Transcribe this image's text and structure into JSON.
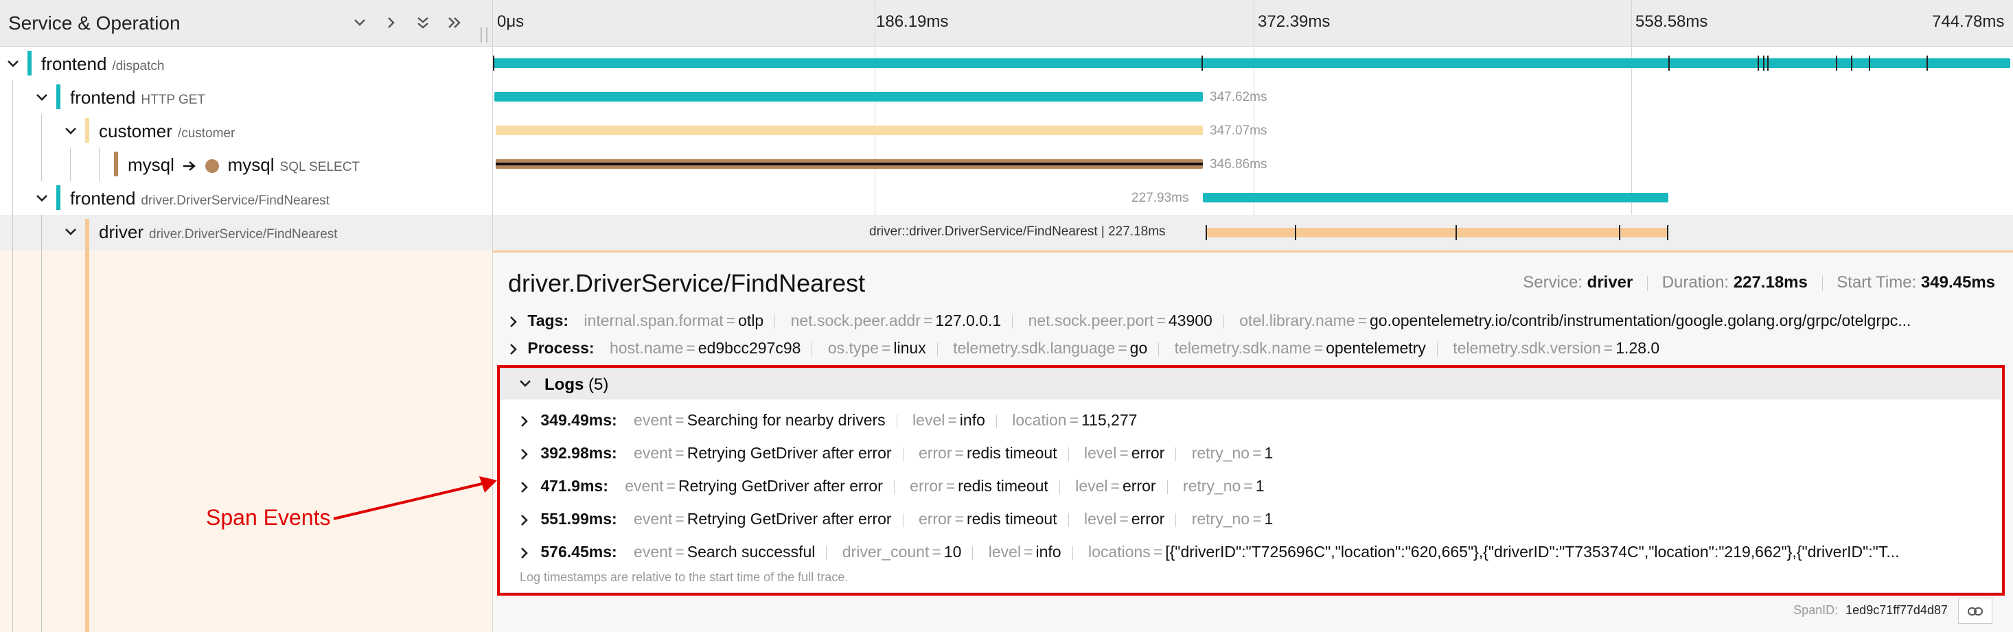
{
  "header": {
    "title": "Service & Operation",
    "ticks": [
      "0μs",
      "186.19ms",
      "372.39ms",
      "558.58ms",
      "744.78ms"
    ]
  },
  "rows": [
    {
      "service": "frontend",
      "operation": "/dispatch",
      "color": "#17b8be"
    },
    {
      "service": "frontend",
      "operation": "HTTP GET",
      "color": "#17b8be",
      "duration": "347.62ms"
    },
    {
      "service": "customer",
      "operation": "/customer",
      "color": "#f8dca1",
      "duration": "347.07ms"
    },
    {
      "service": "mysql",
      "peer": "mysql",
      "operation": "SQL SELECT",
      "color": "#b7885e",
      "duration": "346.86ms"
    },
    {
      "service": "frontend",
      "operation": "driver.DriverService/FindNearest",
      "color": "#17b8be",
      "duration": "227.93ms"
    },
    {
      "service": "driver",
      "operation": "driver.DriverService/FindNearest",
      "color": "#f7c994",
      "label": "driver::driver.DriverService/FindNearest | 227.18ms"
    }
  ],
  "detail": {
    "title": "driver.DriverService/FindNearest",
    "service_label": "Service:",
    "service": "driver",
    "duration_label": "Duration:",
    "duration": "227.18ms",
    "start_label": "Start Time:",
    "start": "349.45ms",
    "tags_label": "Tags:",
    "tags": [
      {
        "k": "internal.span.format",
        "v": "otlp"
      },
      {
        "k": "net.sock.peer.addr",
        "v": "127.0.0.1"
      },
      {
        "k": "net.sock.peer.port",
        "v": "43900"
      },
      {
        "k": "otel.library.name",
        "v": "go.opentelemetry.io/contrib/instrumentation/google.golang.org/grpc/otelgrpc..."
      }
    ],
    "process_label": "Process:",
    "process": [
      {
        "k": "host.name",
        "v": "ed9bcc297c98"
      },
      {
        "k": "os.type",
        "v": "linux"
      },
      {
        "k": "telemetry.sdk.language",
        "v": "go"
      },
      {
        "k": "telemetry.sdk.name",
        "v": "opentelemetry"
      },
      {
        "k": "telemetry.sdk.version",
        "v": "1.28.0"
      }
    ],
    "logs_label": "Logs",
    "logs_count": "(5)",
    "logs": [
      {
        "ts": "349.49ms:",
        "fields": [
          {
            "k": "event",
            "v": "Searching for nearby drivers"
          },
          {
            "k": "level",
            "v": "info"
          },
          {
            "k": "location",
            "v": "115,277"
          }
        ]
      },
      {
        "ts": "392.98ms:",
        "fields": [
          {
            "k": "event",
            "v": "Retrying GetDriver after error"
          },
          {
            "k": "error",
            "v": "redis timeout"
          },
          {
            "k": "level",
            "v": "error"
          },
          {
            "k": "retry_no",
            "v": "1"
          }
        ]
      },
      {
        "ts": "471.9ms:",
        "fields": [
          {
            "k": "event",
            "v": "Retrying GetDriver after error"
          },
          {
            "k": "error",
            "v": "redis timeout"
          },
          {
            "k": "level",
            "v": "error"
          },
          {
            "k": "retry_no",
            "v": "1"
          }
        ]
      },
      {
        "ts": "551.99ms:",
        "fields": [
          {
            "k": "event",
            "v": "Retrying GetDriver after error"
          },
          {
            "k": "error",
            "v": "redis timeout"
          },
          {
            "k": "level",
            "v": "error"
          },
          {
            "k": "retry_no",
            "v": "1"
          }
        ]
      },
      {
        "ts": "576.45ms:",
        "fields": [
          {
            "k": "event",
            "v": "Search successful"
          },
          {
            "k": "driver_count",
            "v": "10"
          },
          {
            "k": "level",
            "v": "info"
          },
          {
            "k": "locations",
            "v": "[{\"driverID\":\"T725696C\",\"location\":\"620,665\"},{\"driverID\":\"T735374C\",\"location\":\"219,662\"},{\"driverID\":\"T..."
          }
        ]
      }
    ],
    "logs_note": "Log timestamps are relative to the start time of the full trace.",
    "spanid_label": "SpanID:",
    "spanid": "1ed9c71ff77d4d87"
  },
  "annotation": {
    "text": "Span Events",
    "color": "#e00000"
  }
}
